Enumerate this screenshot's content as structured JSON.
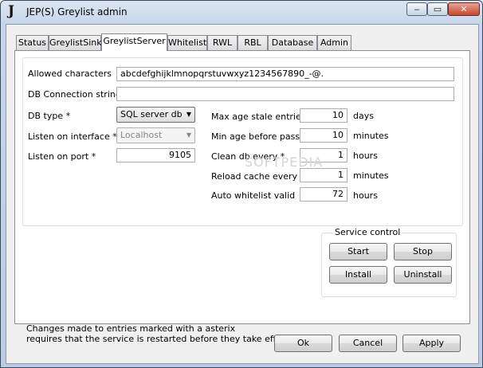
{
  "window": {
    "title": "JEP(S) Greylist admin",
    "icon_letter": "J",
    "min": "‒",
    "max": "▭",
    "close": "✕"
  },
  "tabs": [
    {
      "label": "Status"
    },
    {
      "label": "GreylistSink"
    },
    {
      "label": "GreylistServer"
    },
    {
      "label": "Whitelist"
    },
    {
      "label": "RWL"
    },
    {
      "label": "RBL"
    },
    {
      "label": "Database"
    },
    {
      "label": "Admin"
    }
  ],
  "active_tab": "GreylistServer",
  "form": {
    "allowed_chars_label": "Allowed characters",
    "allowed_chars_value": "abcdefghijklmnopqrstuvwxyz1234567890_-@.",
    "db_conn_label": "DB Connection string *",
    "db_conn_value": "",
    "db_type_label": "DB type *",
    "db_type_value": "SQL server db",
    "listen_iface_label": "Listen on interface *",
    "listen_iface_value": "Localhost",
    "listen_port_label": "Listen on port *",
    "listen_port_value": "9105",
    "max_age_label": "Max age stale entries",
    "max_age_value": "10",
    "max_age_unit": "days",
    "min_age_label": "Min age before pass",
    "min_age_value": "10",
    "min_age_unit": "minutes",
    "clean_db_label": "Clean db every *",
    "clean_db_value": "1",
    "clean_db_unit": "hours",
    "reload_label": "Reload cache every *",
    "reload_value": "1",
    "reload_unit": "minutes",
    "auto_wl_label": "Auto whitelist valid",
    "auto_wl_value": "72",
    "auto_wl_unit": "hours"
  },
  "service": {
    "title": "Service control",
    "start": "Start",
    "stop": "Stop",
    "install": "Install",
    "uninstall": "Uninstall"
  },
  "note": {
    "line1": "Changes made to entries marked with a asterix",
    "line2": "requires that the service is restarted before they take effect."
  },
  "buttons": {
    "ok": "Ok",
    "cancel": "Cancel",
    "apply": "Apply"
  },
  "watermark": "SOFTPEDIA"
}
